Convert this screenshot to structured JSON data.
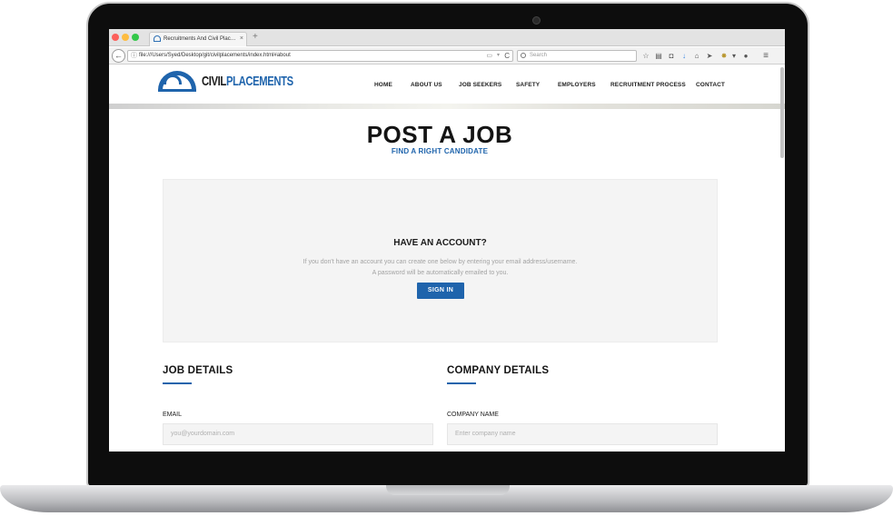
{
  "browser": {
    "tab_title": "Recruitments And Civil Plac…",
    "tab_close": "×",
    "new_tab": "+",
    "url": "file:///Users/Syed/Desktop/git/civilplacements/index.html#about",
    "search_placeholder": "Search",
    "back": "←",
    "reload": "C",
    "toolbar_icons": [
      "star-icon",
      "clipboard-icon",
      "pocket-icon",
      "download-icon",
      "home-icon",
      "send-icon",
      "extension-icon",
      "chat-icon",
      "menu-icon"
    ]
  },
  "site": {
    "logo_part1": "CIVIL",
    "logo_part2": "PLACEMENTS",
    "nav": [
      "HOME",
      "ABOUT US",
      "JOB SEEKERS",
      "SAFETY",
      "EMPLOYERS",
      "RECRUITMENT PROCESS",
      "CONTACT"
    ]
  },
  "page": {
    "title": "POST A JOB",
    "subtitle": "FIND A RIGHT CANDIDATE"
  },
  "account": {
    "heading": "HAVE AN ACCOUNT?",
    "text_line1": "If you don't have an account you can create one below by entering your email address/username.",
    "text_line2": "A password will be automatically emailed to you.",
    "signin_label": "SIGN IN"
  },
  "job_details": {
    "title": "JOB DETAILS",
    "email_label": "EMAIL",
    "email_placeholder": "you@yourdomain.com"
  },
  "company_details": {
    "title": "COMPANY DETAILS",
    "name_label": "COMPANY NAME",
    "name_placeholder": "Enter company name"
  },
  "colors": {
    "brand_blue": "#1f64ac",
    "panel_gray": "#f4f4f4"
  }
}
